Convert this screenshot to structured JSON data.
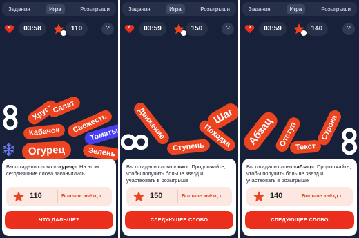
{
  "tabs": [
    "Задания",
    "Игра",
    "Розыгрыши"
  ],
  "active_tab": "Игра",
  "colors": {
    "background": "#17223a",
    "accent": "#ec4421",
    "blue_pill": "#4a3ff0",
    "snowflake": "#6c7cf3"
  },
  "screens": [
    {
      "lives": "4",
      "timer": "03:58",
      "stars": "110",
      "help": "?",
      "words": [
        "Хруст",
        "Салат",
        "Кабачок",
        "Свежесть",
        "Томаты",
        "Огурец",
        "Зелень"
      ],
      "message_prefix": "Вы отгадали слово «",
      "message_word": "огурец",
      "message_suffix": "». На этом сегодняшние слова закончились",
      "star_value": "110",
      "more_stars": "Больше звёзд ›",
      "cta": "ЧТО ДАЛЬШЕ?",
      "icons": [
        "heart-icon",
        "star-icon",
        "snowflake-icon"
      ]
    },
    {
      "lives": "8",
      "timer": "03:59",
      "stars": "150",
      "help": "?",
      "words": [
        "Шаг",
        "Движение",
        "Походка",
        "Ступень"
      ],
      "message_prefix": "Вы отгадали слово «",
      "message_word": "шаг",
      "message_suffix": "». Продолжайте, чтобы получить больше звёзд и участвовать в розыгрыше",
      "star_value": "150",
      "more_stars": "Больше звёзд ›",
      "cta": "СЛЕДУЮЩЕЕ СЛОВО",
      "icons": [
        "heart-icon",
        "star-icon"
      ]
    },
    {
      "lives": "9",
      "timer": "03:59",
      "stars": "140",
      "help": "?",
      "words": [
        "Абзац",
        "Отступ",
        "Текст",
        "Строка"
      ],
      "message_prefix": "Вы отгадали слово «",
      "message_word": "абзац",
      "message_suffix": "». Продолжайте, чтобы получить больше звёзд и участвовать в розыгрыше",
      "star_value": "140",
      "more_stars": "Больше звёзд ›",
      "cta": "СЛЕДУЮЩЕЕ СЛОВО",
      "icons": [
        "heart-icon",
        "star-icon"
      ]
    }
  ]
}
